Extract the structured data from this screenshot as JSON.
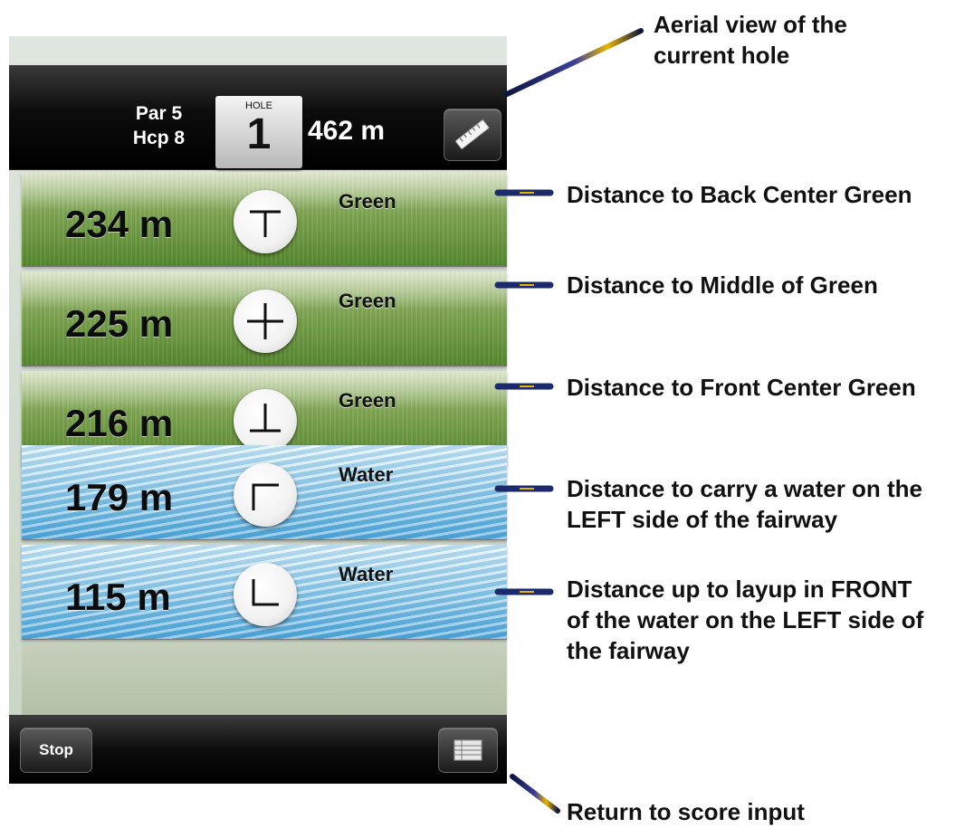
{
  "header": {
    "par": "Par 5",
    "hcp": "Hcp 8",
    "hole_label": "HOLE",
    "hole_number": "1",
    "hole_distance": "462 m",
    "aerial_icon": "ruler-icon"
  },
  "rows": [
    {
      "distance": "234 m",
      "target": "Green",
      "icon": "back-center-icon",
      "terrain": "green"
    },
    {
      "distance": "225 m",
      "target": "Green",
      "icon": "middle-cross-icon",
      "terrain": "green"
    },
    {
      "distance": "216 m",
      "target": "Green",
      "icon": "front-center-icon",
      "terrain": "green"
    },
    {
      "distance": "179 m",
      "target": "Water",
      "icon": "carry-corner-icon",
      "terrain": "water"
    },
    {
      "distance": "115 m",
      "target": "Water",
      "icon": "layup-corner-icon",
      "terrain": "water"
    }
  ],
  "footer": {
    "stop_label": "Stop",
    "score_icon": "scorecard-icon"
  },
  "annotations": {
    "aerial_line1": "Aerial view of the",
    "aerial_line2": "current hole",
    "back_center": "Distance to Back Center Green",
    "middle": "Distance to Middle of Green",
    "front_center": "Distance to Front Center Green",
    "carry_line1": "Distance to carry a water on the",
    "carry_line2": "LEFT side of the fairway",
    "layup_line1": "Distance up to layup in FRONT",
    "layup_line2": "of the water on the LEFT side of",
    "layup_line3": "the fairway",
    "score": "Return to score input"
  },
  "colors": {
    "pointer": "#1a2a6a",
    "pointer_highlight": "#e8b400",
    "green_dark": "#56882e",
    "water_dark": "#4aa2d6"
  }
}
